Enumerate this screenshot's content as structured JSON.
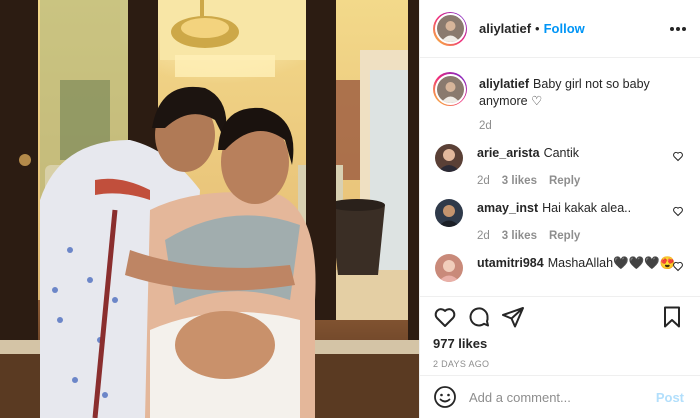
{
  "post": {
    "author": "aliylatief",
    "follow_label": "Follow",
    "separator": "•",
    "caption_user": "aliylatief",
    "caption_text": "Baby girl not so baby anymore ♡",
    "caption_time": "2d",
    "likes": "977 likes",
    "posted": "2 DAYS AGO",
    "icons": [
      "more-options-icon",
      "like-heart-icon",
      "comment-icon",
      "share-icon",
      "save-bookmark-icon",
      "emoji-icon"
    ]
  },
  "comments": [
    {
      "user": "arie_arista",
      "text": "Cantik",
      "time": "2d",
      "likes": "3 likes",
      "reply": "Reply",
      "avatar_color": "#5a4036"
    },
    {
      "user": "amay_inst",
      "text": "Hai kakak alea..",
      "time": "2d",
      "likes": "3 likes",
      "reply": "Reply",
      "avatar_color": "#2f3a4a"
    },
    {
      "user": "utamitri984",
      "text": "MashaAllah🖤🖤🖤😍",
      "time": "",
      "likes": "",
      "reply": "",
      "avatar_color": "#c98a7a"
    }
  ],
  "composer": {
    "placeholder": "Add a comment...",
    "post_label": "Post"
  },
  "colors": {
    "link_blue": "#0095f6",
    "post_disabled": "#b2dffc",
    "muted": "#8e8e8e",
    "text": "#262626"
  }
}
